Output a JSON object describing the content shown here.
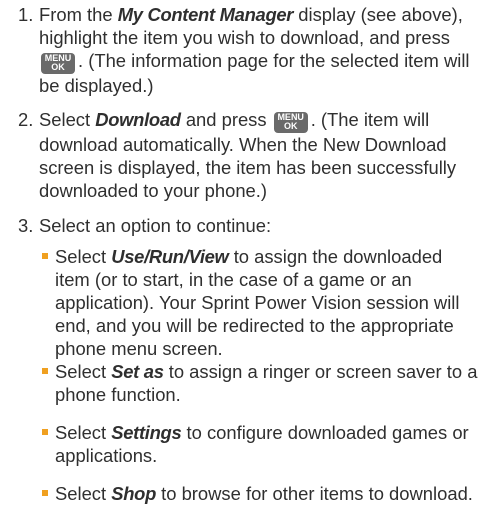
{
  "key_label": {
    "top": "MENU",
    "bottom": "OK"
  },
  "colors": {
    "bullet": "#f0a020",
    "key_bg": "#6a6a6a",
    "text": "#2f2f2f"
  },
  "steps": [
    {
      "number": "1.",
      "text_a": "From the ",
      "em_a": "My Content Manager",
      "text_b": " display (see above), highlight the item you wish to download, and press ",
      "text_c": ". (The information page for the selected item will be displayed.)"
    },
    {
      "number": "2.",
      "text_a": "Select ",
      "em_a": "Download",
      "text_b": " and press ",
      "text_c": ". (The item will download automatically. When the New Download screen is displayed, the item has been successfully downloaded to your phone.)"
    },
    {
      "number": "3.",
      "text": "Select an option to continue:"
    }
  ],
  "options": [
    {
      "pre": "Select ",
      "em": "Use/Run/View",
      "post": " to assign the downloaded item (or to start, in the case of a game or an application). Your Sprint Power Vision session will end, and you will be redirected to the appropriate phone menu screen."
    },
    {
      "pre": "Select ",
      "em": "Set as",
      "post": " to assign a ringer or screen saver to a phone function."
    },
    {
      "pre": "Select ",
      "em": "Settings",
      "post": " to configure downloaded games or applications."
    },
    {
      "pre": "Select ",
      "em": "Shop",
      "post": " to browse for other items to download."
    }
  ]
}
